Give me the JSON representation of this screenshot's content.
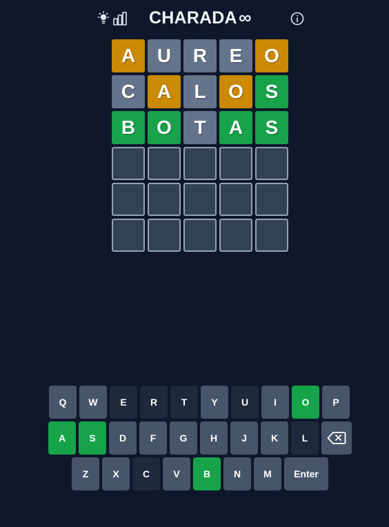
{
  "header": {
    "title": "CHARADA",
    "infinity_symbol": "∞",
    "icons": [
      "theme-icon",
      "stats-icon",
      "info-icon"
    ]
  },
  "colors": {
    "background": "#0f172a",
    "present": "#ca8a04",
    "absent_tile": "#64748b",
    "correct": "#16a34a",
    "empty_tile": "#334155",
    "key_default": "#475569",
    "key_absent": "#1e293b"
  },
  "board": {
    "rows": [
      [
        {
          "letter": "A",
          "state": "present"
        },
        {
          "letter": "U",
          "state": "absent"
        },
        {
          "letter": "R",
          "state": "absent"
        },
        {
          "letter": "E",
          "state": "absent"
        },
        {
          "letter": "O",
          "state": "present"
        }
      ],
      [
        {
          "letter": "C",
          "state": "absent"
        },
        {
          "letter": "A",
          "state": "present"
        },
        {
          "letter": "L",
          "state": "absent"
        },
        {
          "letter": "O",
          "state": "present"
        },
        {
          "letter": "S",
          "state": "correct"
        }
      ],
      [
        {
          "letter": "B",
          "state": "correct"
        },
        {
          "letter": "O",
          "state": "correct"
        },
        {
          "letter": "T",
          "state": "absent"
        },
        {
          "letter": "A",
          "state": "correct"
        },
        {
          "letter": "S",
          "state": "correct"
        }
      ],
      [
        {
          "letter": "",
          "state": "empty"
        },
        {
          "letter": "",
          "state": "empty"
        },
        {
          "letter": "",
          "state": "empty"
        },
        {
          "letter": "",
          "state": "empty"
        },
        {
          "letter": "",
          "state": "empty"
        }
      ],
      [
        {
          "letter": "",
          "state": "empty"
        },
        {
          "letter": "",
          "state": "empty"
        },
        {
          "letter": "",
          "state": "empty"
        },
        {
          "letter": "",
          "state": "empty"
        },
        {
          "letter": "",
          "state": "empty"
        }
      ],
      [
        {
          "letter": "",
          "state": "empty"
        },
        {
          "letter": "",
          "state": "empty"
        },
        {
          "letter": "",
          "state": "empty"
        },
        {
          "letter": "",
          "state": "empty"
        },
        {
          "letter": "",
          "state": "empty"
        }
      ]
    ]
  },
  "keyboard": {
    "rows": [
      [
        {
          "label": "Q",
          "state": "default"
        },
        {
          "label": "W",
          "state": "default"
        },
        {
          "label": "E",
          "state": "absent"
        },
        {
          "label": "R",
          "state": "absent"
        },
        {
          "label": "T",
          "state": "absent"
        },
        {
          "label": "Y",
          "state": "default"
        },
        {
          "label": "U",
          "state": "absent"
        },
        {
          "label": "I",
          "state": "default"
        },
        {
          "label": "O",
          "state": "correct"
        },
        {
          "label": "P",
          "state": "default"
        }
      ],
      [
        {
          "label": "A",
          "state": "correct"
        },
        {
          "label": "S",
          "state": "correct"
        },
        {
          "label": "D",
          "state": "default"
        },
        {
          "label": "F",
          "state": "default"
        },
        {
          "label": "G",
          "state": "default"
        },
        {
          "label": "H",
          "state": "default"
        },
        {
          "label": "J",
          "state": "default"
        },
        {
          "label": "K",
          "state": "default"
        },
        {
          "label": "L",
          "state": "absent"
        },
        {
          "label": "",
          "state": "default",
          "icon": "backspace-icon"
        }
      ],
      [
        {
          "label": "Z",
          "state": "default"
        },
        {
          "label": "X",
          "state": "default"
        },
        {
          "label": "C",
          "state": "absent"
        },
        {
          "label": "V",
          "state": "default"
        },
        {
          "label": "B",
          "state": "correct"
        },
        {
          "label": "N",
          "state": "default"
        },
        {
          "label": "M",
          "state": "default"
        },
        {
          "label": "Enter",
          "state": "default"
        }
      ]
    ]
  }
}
